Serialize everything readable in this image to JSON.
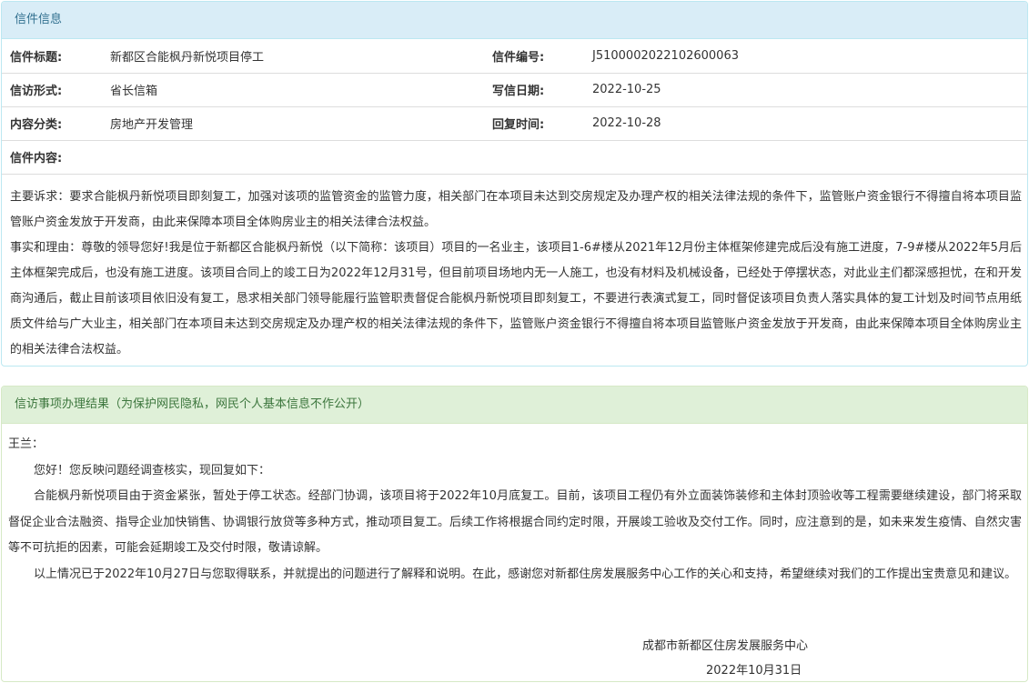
{
  "letter": {
    "heading": "信件信息",
    "rows": [
      {
        "label1": "信件标题:",
        "value1": "新都区合能枫丹新悦项目停工",
        "label2": "信件编号:",
        "value2": "J5100002022102600063"
      },
      {
        "label1": "信访形式:",
        "value1": "省长信箱",
        "label2": "写信日期:",
        "value2": "2022-10-25"
      },
      {
        "label1": "内容分类:",
        "value1": "房地产开发管理",
        "label2": "回复时间:",
        "value2": "2022-10-28"
      }
    ],
    "content_label": "信件内容:",
    "content_paragraphs": [
      "主要诉求：要求合能枫丹新悦项目即刻复工，加强对该项的监管资金的监管力度，相关部门在本项目未达到交房规定及办理产权的相关法律法规的条件下，监管账户资金银行不得擅自将本项目监管账户资金发放于开发商，由此来保障本项目全体购房业主的相关法律合法权益。",
      "事实和理由：尊敬的领导您好!我是位于新都区合能枫丹新悦（以下简称：该项目）项目的一名业主，该项目1-6#楼从2021年12月份主体框架修建完成后没有施工进度，7-9#楼从2022年5月后主体框架完成后，也没有施工进度。该项目合同上的竣工日为2022年12月31号，但目前项目场地内无一人施工，也没有材料及机械设备，已经处于停摆状态，对此业主们都深感担忧，在和开发商沟通后，截止目前该项目依旧没有复工，恳求相关部门领导能履行监管职责督促合能枫丹新悦项目即刻复工，不要进行表演式复工，同时督促该项目负责人落实具体的复工计划及时间节点用纸质文件给与广大业主，相关部门在本项目未达到交房规定及办理产权的相关法律法规的条件下，监管账户资金银行不得擅自将本项目监管账户资金发放于开发商，由此来保障本项目全体购房业主的相关法律合法权益。"
    ]
  },
  "result": {
    "heading": "信访事项办理结果（为保护网民隐私，网民个人基本信息不作公开）",
    "salutation": "王兰：",
    "paragraphs": [
      "您好！您反映问题经调查核实，现回复如下：",
      "合能枫丹新悦项目由于资金紧张，暂处于停工状态。经部门协调，该项目将于2022年10月底复工。目前，该项目工程仍有外立面装饰装修和主体封顶验收等工程需要继续建设，部门将采取督促企业合法融资、指导企业加快销售、协调银行放贷等多种方式，推动项目复工。后续工作将根据合同约定时限，开展竣工验收及交付工作。同时，应注意到的是，如未来发生疫情、自然灾害等不可抗拒的因素，可能会延期竣工及交付时限，敬请谅解。",
      "以上情况已于2022年10月27日与您取得联系，并就提出的问题进行了解释和说明。在此，感谢您对新都住房发展服务中心工作的关心和支持，希望继续对我们的工作提出宝贵意见和建议。"
    ],
    "signature": "成都市新都区住房发展服务中心",
    "date": "2022年10月31日"
  },
  "colors": {
    "info_heading_bg": "#d9edf7",
    "info_heading_text": "#31708f",
    "result_heading_bg": "#dff0d8",
    "result_heading_text": "#3c763d"
  }
}
